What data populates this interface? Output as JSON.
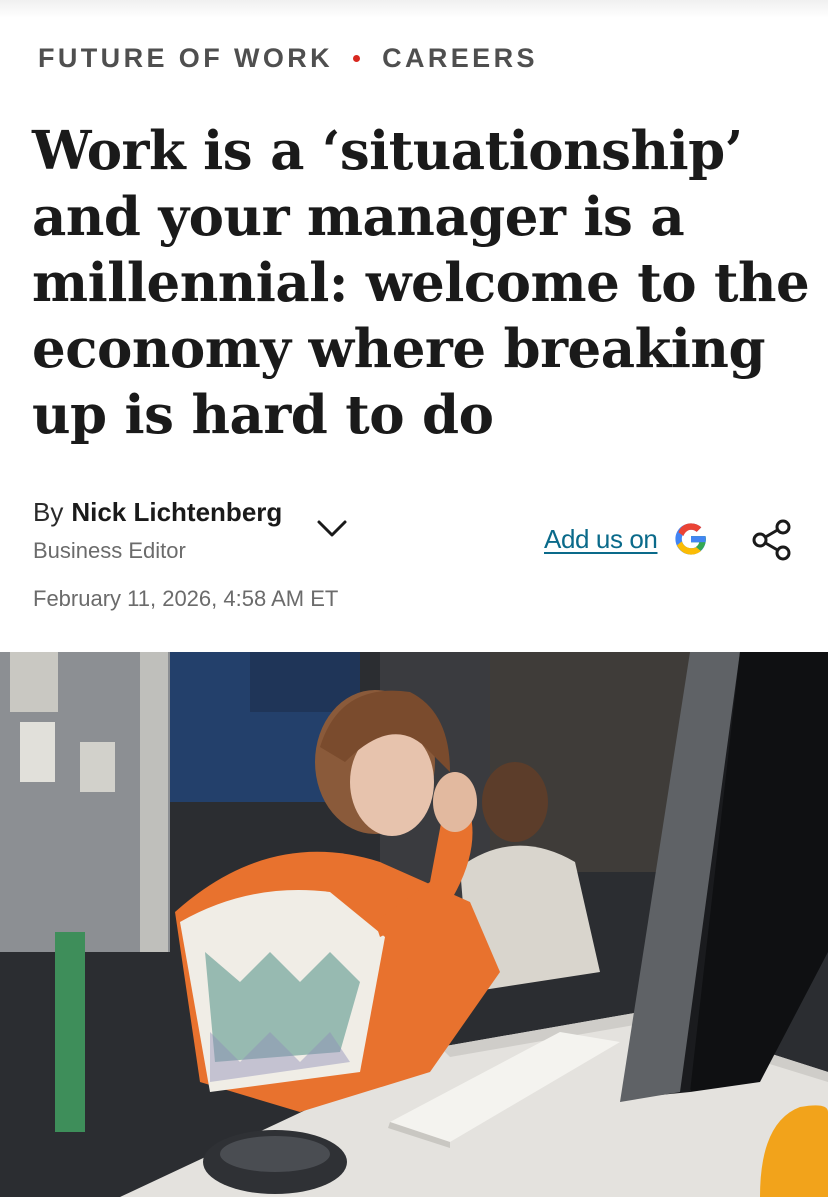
{
  "eyebrow": {
    "section": "FUTURE OF WORK",
    "topic": "CAREERS",
    "dot_color": "#d8281f"
  },
  "article": {
    "headline": "Work is a ‘situationship’ and your manager is a millennial: welcome to the economy where breaking up is hard to do",
    "by_prefix": "By",
    "author": "Nick Lichtenberg",
    "author_role": "Business Editor",
    "date": "February 11, 2026, 4:58 AM ET"
  },
  "actions": {
    "add_us_label": "Add us on",
    "add_us_icon": "google-g-icon",
    "share_icon": "share-icon",
    "expand_icon": "chevron-down-icon",
    "link_color": "#0a6a8a"
  },
  "hero_image": {
    "subject": "photo"
  }
}
